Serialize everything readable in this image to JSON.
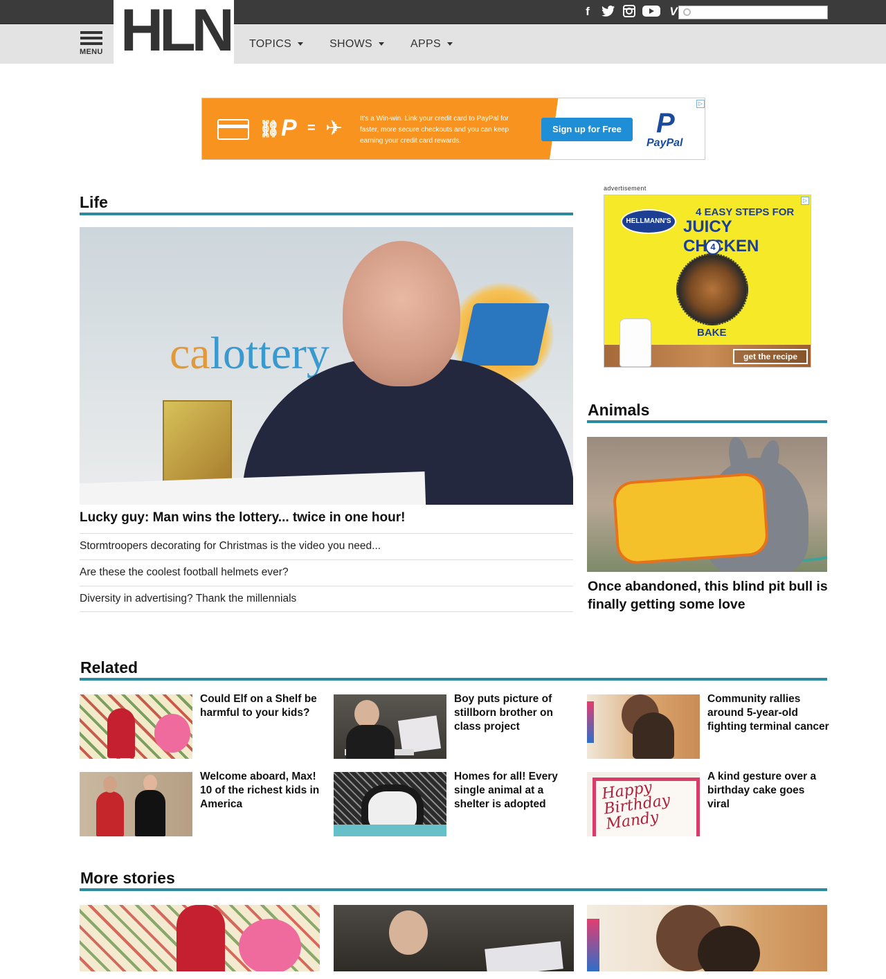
{
  "header": {
    "logo": "HLN",
    "menu_label": "MENU",
    "nav": [
      {
        "label": "TOPICS"
      },
      {
        "label": "SHOWS"
      },
      {
        "label": "APPS"
      }
    ],
    "social": [
      {
        "icon": "facebook-icon",
        "glyph": "f"
      },
      {
        "icon": "twitter-icon",
        "glyph": "🐦"
      },
      {
        "icon": "instagram-icon",
        "glyph": "◙"
      },
      {
        "icon": "youtube-icon",
        "glyph": "▶"
      },
      {
        "icon": "vine-icon",
        "glyph": "V"
      }
    ],
    "search": {
      "placeholder": "",
      "value": ""
    }
  },
  "banner_ad": {
    "text": "It's a Win-win. Link your credit card to PayPal for faster, more secure checkouts and you can keep earning your credit card rewards.",
    "button": "Sign up for Free",
    "brand_mark": "P",
    "brand": "PayPal"
  },
  "life": {
    "title": "Life",
    "hero_brand_a": "ca",
    "hero_brand_b": "lottery",
    "lead_headline": "Lucky guy: Man wins the lottery... twice in one hour!",
    "stories": [
      {
        "title": "Stormtroopers decorating for Christmas is the video you need..."
      },
      {
        "title": "Are these the coolest football helmets ever?"
      },
      {
        "title": "Diversity in advertising? Thank the millennials"
      }
    ]
  },
  "side_ad": {
    "label": "advertisement",
    "brand": "HELLMANN'S",
    "line1": "4 EASY STEPS FOR",
    "line2": "JUICY CHICKEN",
    "step": "4",
    "step_label": "BAKE",
    "cta": "get the recipe"
  },
  "animals": {
    "title": "Animals",
    "headline": "Once abandoned, this blind pit bull is finally getting some love"
  },
  "related": {
    "title": "Related",
    "items": [
      {
        "title": "Could Elf on a Shelf be harmful to your kids?"
      },
      {
        "title": "Boy puts picture of stillborn brother on class project",
        "caption": "Stillborn Baby in Class Project"
      },
      {
        "title": "Community rallies around 5-year-old fighting terminal cancer"
      },
      {
        "title": "Welcome aboard, Max! 10 of the richest kids in America"
      },
      {
        "title": "Homes for all! Every single animal at a shelter is adopted"
      },
      {
        "title": "A kind gesture over a birthday cake goes viral",
        "cake_text": "Happy Birthday Mandy"
      }
    ]
  },
  "more_stories": {
    "title": "More stories"
  },
  "colors": {
    "accent_rule": "#2b8aa0",
    "topbar": "#3b3b3b",
    "navbar": "#e3e3e3"
  }
}
